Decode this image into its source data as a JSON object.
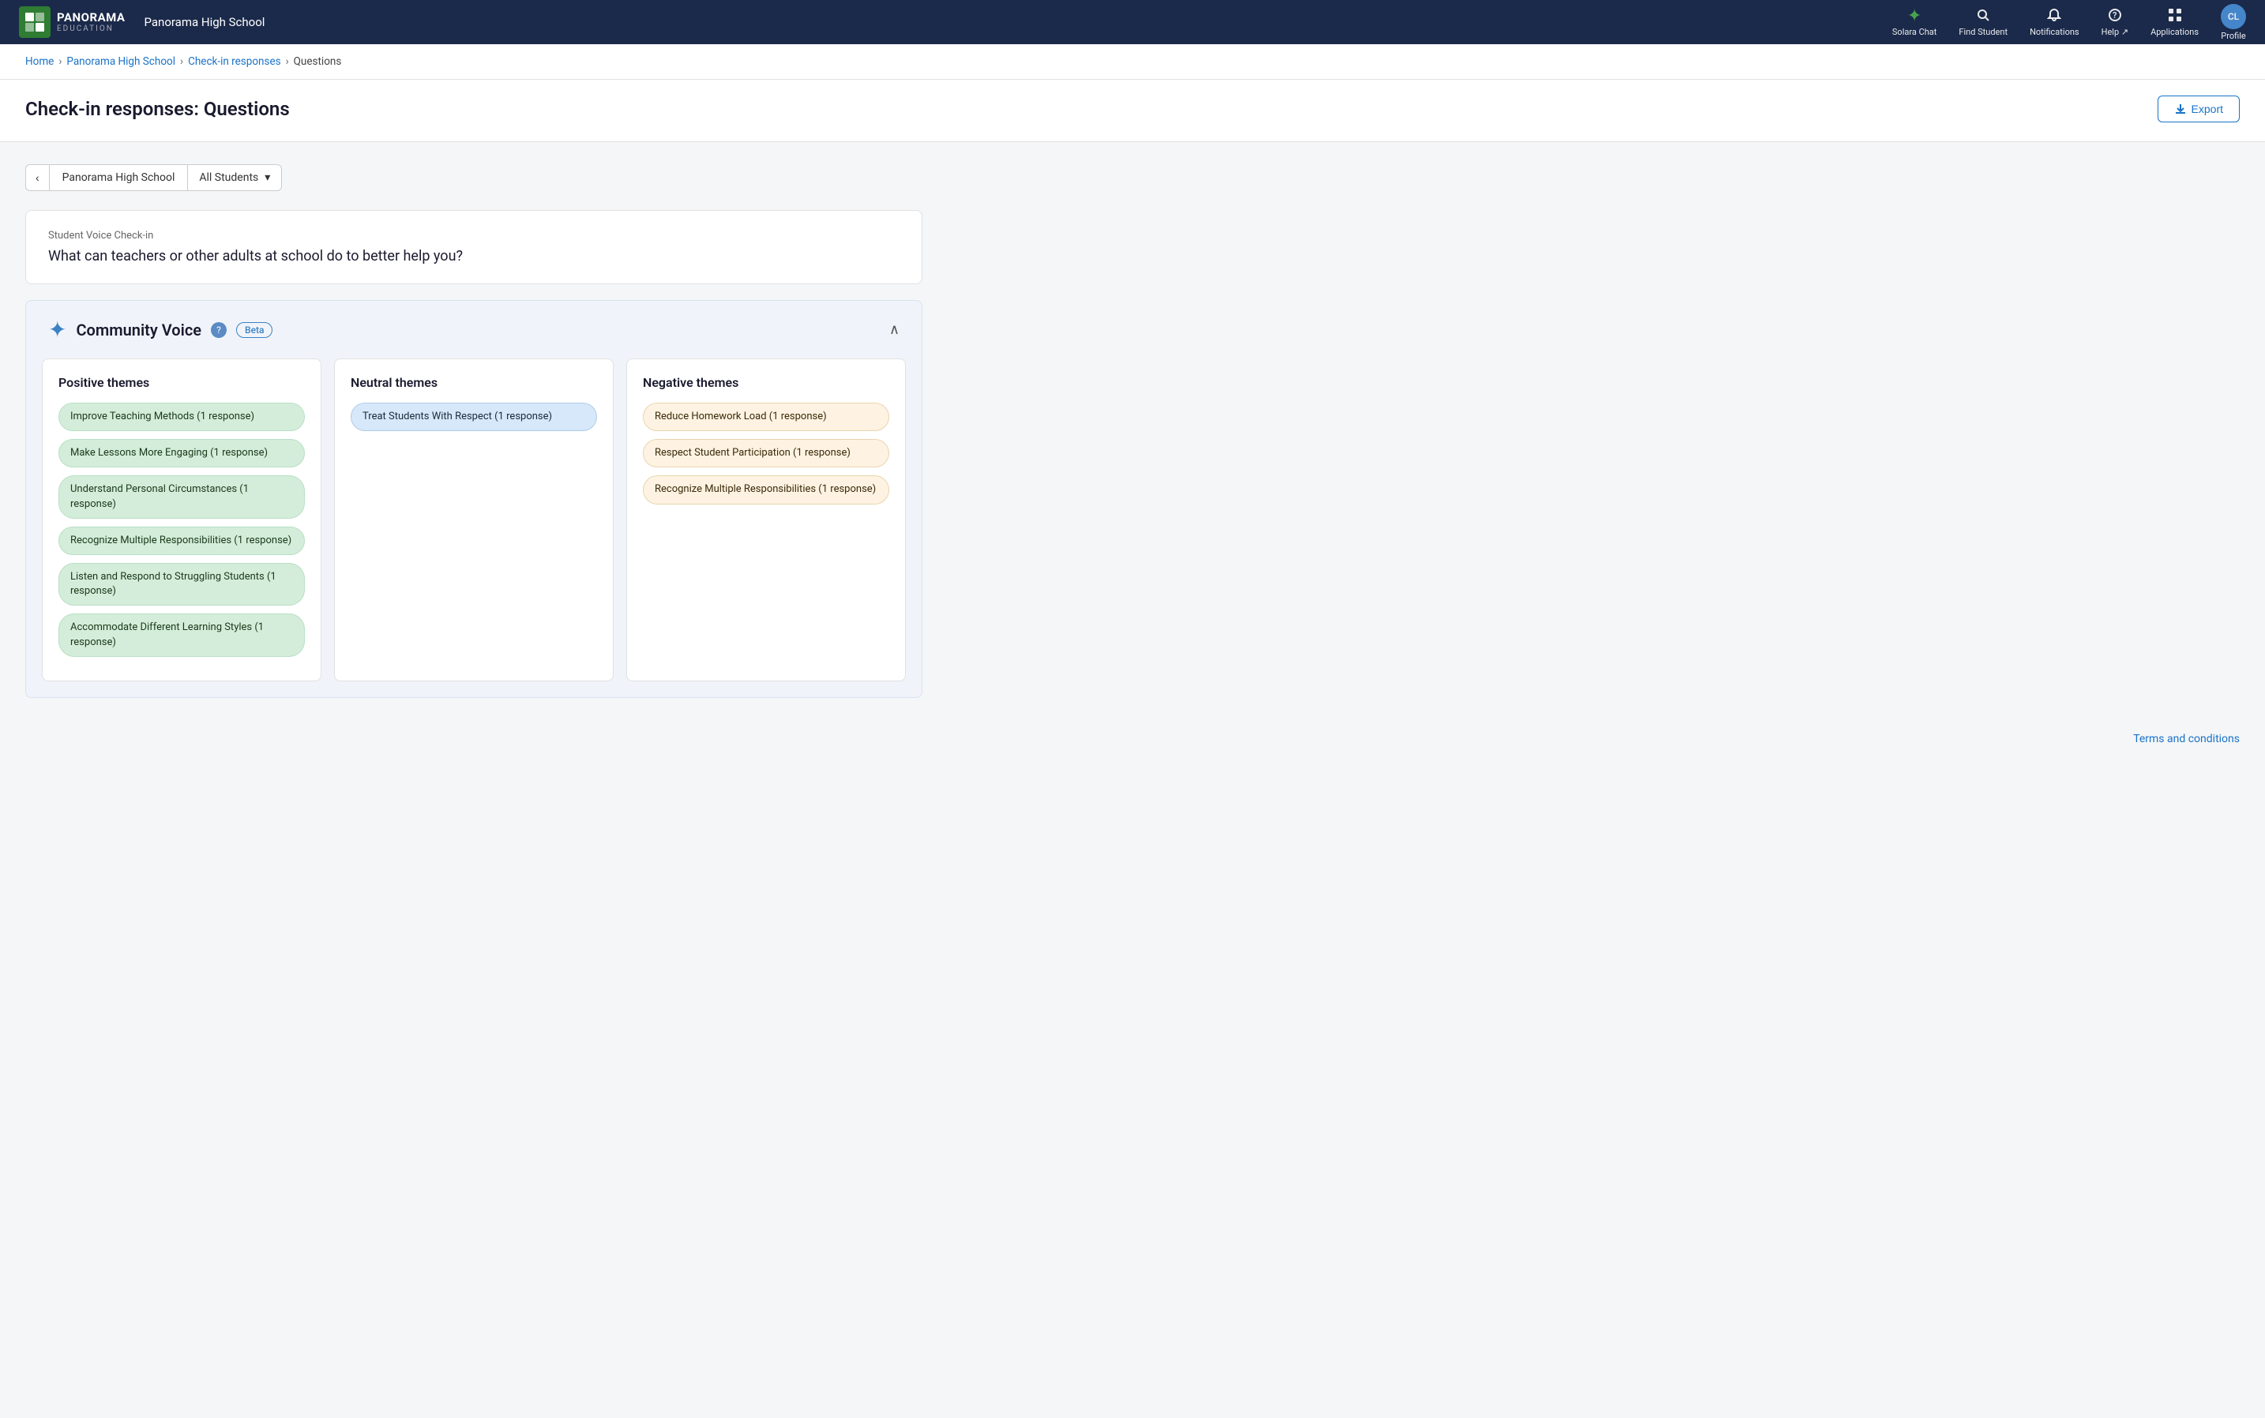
{
  "navbar": {
    "logo_brand": "PANORAMA",
    "logo_sub": "EDUCATION",
    "logo_initials": "P",
    "school_name": "Panorama High School",
    "nav_items": [
      {
        "id": "solara-chat",
        "icon": "✦",
        "label": "Solara Chat",
        "is_star": true
      },
      {
        "id": "find-student",
        "icon": "🔍",
        "label": "Find Student"
      },
      {
        "id": "notifications",
        "icon": "🔔",
        "label": "Notifications"
      },
      {
        "id": "help",
        "icon": "❓",
        "label": "Help ↗"
      },
      {
        "id": "applications",
        "icon": "⊞",
        "label": "Applications"
      }
    ],
    "profile_initials": "CL",
    "profile_label": "Profile"
  },
  "breadcrumb": {
    "home": "Home",
    "school": "Panorama High School",
    "section": "Check-in responses",
    "current": "Questions"
  },
  "page_header": {
    "title": "Check-in responses: Questions",
    "export_label": "Export"
  },
  "filter_bar": {
    "back_icon": "‹",
    "school_label": "Panorama High School",
    "dropdown_label": "All Students",
    "dropdown_icon": "▾"
  },
  "question_card": {
    "survey_label": "Student Voice Check-in",
    "question_text": "What can teachers or other adults at school do to better help you?"
  },
  "community_voice": {
    "title": "Community Voice",
    "help_icon": "?",
    "beta_label": "Beta",
    "collapse_icon": "∧",
    "columns": [
      {
        "id": "positive",
        "title": "Positive themes",
        "type": "positive",
        "tags": [
          "Improve Teaching Methods (1 response)",
          "Make Lessons More Engaging (1 response)",
          "Understand Personal Circumstances (1 response)",
          "Recognize Multiple Responsibilities (1 response)",
          "Listen and Respond to Struggling Students (1 response)",
          "Accommodate Different Learning Styles (1 response)"
        ]
      },
      {
        "id": "neutral",
        "title": "Neutral themes",
        "type": "neutral",
        "tags": [
          "Treat Students With Respect (1 response)"
        ]
      },
      {
        "id": "negative",
        "title": "Negative themes",
        "type": "negative",
        "tags": [
          "Reduce Homework Load (1 response)",
          "Respect Student Participation (1 response)",
          "Recognize Multiple Responsibilities (1 response)"
        ]
      }
    ]
  },
  "footer": {
    "terms_label": "Terms and conditions"
  }
}
